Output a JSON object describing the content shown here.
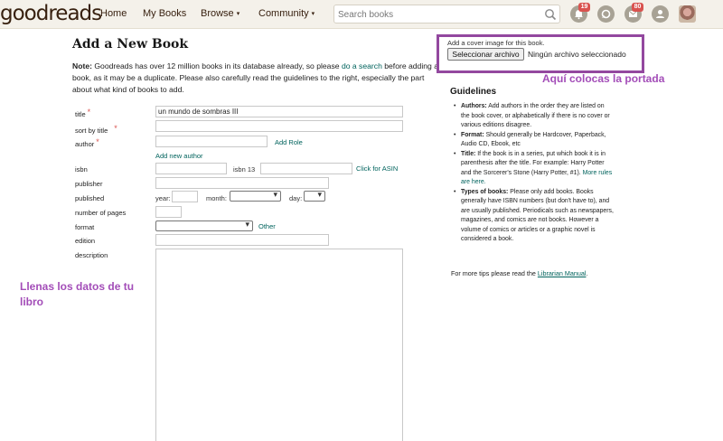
{
  "header": {
    "logo": "goodreads",
    "nav": [
      {
        "label": "Home"
      },
      {
        "label": "My Books"
      },
      {
        "label": "Browse",
        "caret": "▾"
      },
      {
        "label": "Community",
        "caret": "▾"
      }
    ],
    "search_placeholder": "Search books",
    "notifications_count": "19",
    "messages_count": "80"
  },
  "page": {
    "title": "Add a New Book",
    "note_bold": "Note:",
    "note_1": " Goodreads has over 12 million books in its database already, so please ",
    "note_link_1": "do a search",
    "note_2": " before adding a book, as it may be a duplicate. Please also carefully read the guidelines to the right, especially the part about what kind of books to add."
  },
  "form": {
    "title_label": "title",
    "title_value": "un mundo de sombras III",
    "sort_label": "sort by title",
    "author_label": "author",
    "add_role": "Add Role",
    "add_author": "Add new author",
    "isbn_label": "isbn",
    "isbn13_label": "isbn 13",
    "click_asin": "Click for ASIN",
    "publisher_label": "publisher",
    "published_label": "published",
    "year_label": "year:",
    "month_label": "month:",
    "day_label": "day:",
    "pages_label": "number of pages",
    "format_label": "format",
    "other_link": "Other",
    "edition_label": "edition",
    "description_label": "description",
    "required_mark": "*"
  },
  "cover": {
    "label": "Add a cover image for this book.",
    "button": "Seleccionar archivo",
    "status": "Ningún archivo seleccionado"
  },
  "annotations": {
    "cover_note": "Aquí colocas la portada",
    "fill_note": "Llenas los datos de tu libro",
    "color": "#a34db8"
  },
  "guidelines": {
    "title": "Guidelines",
    "items": [
      {
        "bold": "Authors:",
        "text": " Add authors in the order they are listed on the book cover, or alphabetically if there is no cover or various editions disagree."
      },
      {
        "bold": "Format:",
        "text": " Should generally be Hardcover, Paperback, Audio CD, Ebook, etc"
      },
      {
        "bold": "Title:",
        "text": " If the book is in a series, put which book it is in parenthesis after the title. For example: Harry Potter and the Sorcerer's Stone (Harry Potter, #1).",
        "more": " More rules are here."
      },
      {
        "bold": "Types of books:",
        "text": " Please only add books. Books generally have ISBN numbers (but don't have to), and are usually published. Periodicals such as newspapers, magazines, and comics are not books. However a volume of comics or articles or a graphic novel is considered a book."
      }
    ],
    "tips_text": "For more tips please read the ",
    "tips_link": "Librarian Manual",
    "tips_end": "."
  }
}
